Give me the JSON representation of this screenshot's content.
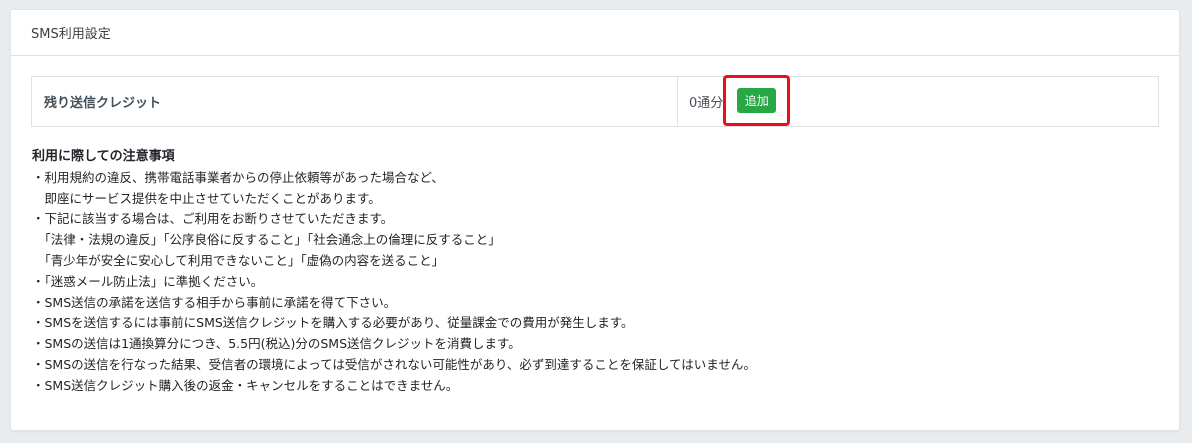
{
  "header": {
    "title": "SMS利用設定"
  },
  "credit": {
    "label": "残り送信クレジット",
    "value": "0通分",
    "add_label": "追加"
  },
  "notes": {
    "title": "利用に際しての注意事項",
    "lines": [
      "・利用規約の違反、携帯電話事業者からの停止依頼等があった場合など、",
      "　即座にサービス提供を中止させていただくことがあります。",
      "・下記に該当する場合は、ご利用をお断りさせていただきます。",
      "　「法律・法規の違反」「公序良俗に反すること」「社会通念上の倫理に反すること」",
      "　「青少年が安全に安心して利用できないこと」「虚偽の内容を送ること」",
      "・「迷惑メール防止法」に準拠ください。",
      "・SMS送信の承諾を送信する相手から事前に承諾を得て下さい。",
      "・SMSを送信するには事前にSMS送信クレジットを購入する必要があり、従量課金での費用が発生します。",
      "・SMSの送信は1通換算分につき、5.5円(税込)分のSMS送信クレジットを消費します。",
      "・SMSの送信を行なった結果、受信者の環境によっては受信がされない可能性があり、必ず到達することを保証してはいません。",
      "・SMS送信クレジット購入後の返金・キャンセルをすることはできません。"
    ]
  },
  "colors": {
    "accent_green": "#28a745",
    "highlight_red": "#e8101a",
    "page_background": "#e9ecef"
  }
}
